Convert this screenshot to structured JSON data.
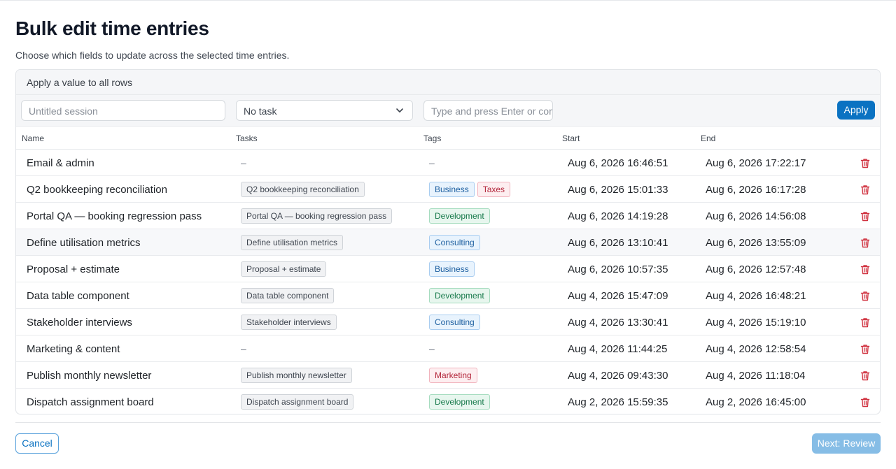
{
  "page": {
    "title": "Bulk edit time entries",
    "subtitle": "Choose which fields to update across the selected time entries."
  },
  "apply_all": {
    "heading": "Apply a value to all rows",
    "name_placeholder": "Untitled session",
    "task_select_value": "No task",
    "tags_placeholder": "Type and press Enter or comma",
    "apply_label": "Apply"
  },
  "table": {
    "columns": {
      "name": "Name",
      "tasks": "Tasks",
      "tags": "Tags",
      "start": "Start",
      "end": "End"
    },
    "rows": [
      {
        "name": "Email & admin",
        "task": "–",
        "tags": [
          "–"
        ],
        "start": "Aug 6, 2026 16:46:51",
        "end": "Aug 6, 2026 17:22:17"
      },
      {
        "name": "Q2 bookkeeping reconciliation",
        "task": "Q2 bookkeeping reconciliation",
        "tags": [
          "Business",
          "Taxes"
        ],
        "start": "Aug 6, 2026 15:01:33",
        "end": "Aug 6, 2026 16:17:28"
      },
      {
        "name": "Portal QA — booking regression pass",
        "task": "Portal QA — booking regression pass",
        "tags": [
          "Development"
        ],
        "start": "Aug 6, 2026 14:19:28",
        "end": "Aug 6, 2026 14:56:08"
      },
      {
        "name": "Define utilisation metrics",
        "task": "Define utilisation metrics",
        "tags": [
          "Consulting"
        ],
        "start": "Aug 6, 2026 13:10:41",
        "end": "Aug 6, 2026 13:55:09"
      },
      {
        "name": "Proposal + estimate",
        "task": "Proposal + estimate",
        "tags": [
          "Business"
        ],
        "start": "Aug 6, 2026 10:57:35",
        "end": "Aug 6, 2026 12:57:48"
      },
      {
        "name": "Data table component",
        "task": "Data table component",
        "tags": [
          "Development"
        ],
        "start": "Aug 4, 2026 15:47:09",
        "end": "Aug 4, 2026 16:48:21"
      },
      {
        "name": "Stakeholder interviews",
        "task": "Stakeholder interviews",
        "tags": [
          "Consulting"
        ],
        "start": "Aug 4, 2026 13:30:41",
        "end": "Aug 4, 2026 15:19:10"
      },
      {
        "name": "Marketing & content",
        "task": "–",
        "tags": [
          "–"
        ],
        "start": "Aug 4, 2026 11:44:25",
        "end": "Aug 4, 2026 12:58:54"
      },
      {
        "name": "Publish monthly newsletter",
        "task": "Publish monthly newsletter",
        "tags": [
          "Marketing"
        ],
        "start": "Aug 4, 2026 09:43:30",
        "end": "Aug 4, 2026 11:18:04"
      },
      {
        "name": "Dispatch assignment board",
        "task": "Dispatch assignment board",
        "tags": [
          "Development"
        ],
        "start": "Aug 2, 2026 15:59:35",
        "end": "Aug 2, 2026 16:45:00"
      }
    ]
  },
  "footer": {
    "cancel_label": "Cancel",
    "next_label": "Next: Review"
  },
  "colors": {
    "primary": "#0a72c2",
    "primary_disabled": "#86bde6",
    "danger_icon": "#d0313f"
  },
  "icons": {
    "delete": "trash-icon",
    "select": "chevron-down-icon"
  }
}
